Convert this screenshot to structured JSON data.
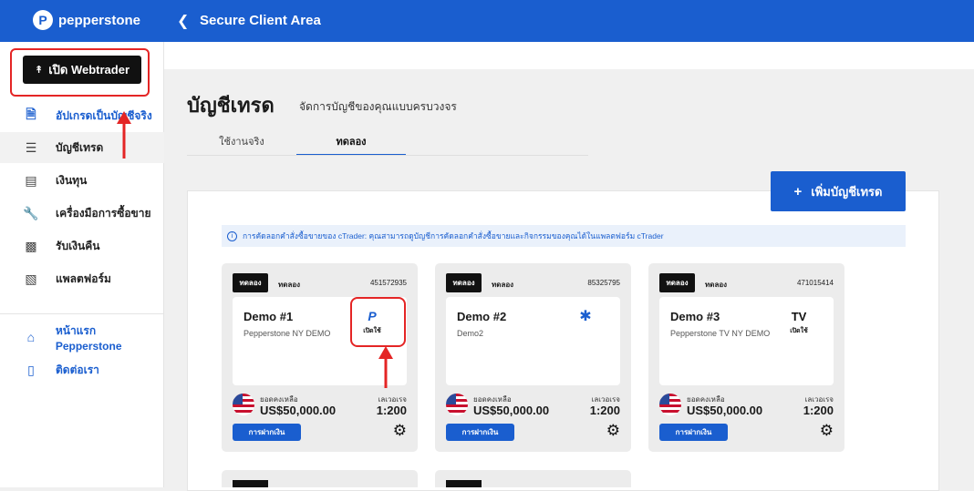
{
  "header": {
    "brand": "pepperstone",
    "back_icon": "chevron-left-icon",
    "title": "Secure Client Area"
  },
  "sidebar": {
    "webtrader_label": "เปิด Webtrader",
    "items": [
      {
        "label": "อัปเกรดเป็นบัญชีจริง",
        "icon": "document-icon"
      },
      {
        "label": "บัญชีเทรด",
        "icon": "layers-icon"
      },
      {
        "label": "เงินทุน",
        "icon": "wallet-icon"
      },
      {
        "label": "เครื่องมือการซื้อขาย",
        "icon": "wrench-icon"
      },
      {
        "label": "รับเงินคืน",
        "icon": "user-card-icon"
      },
      {
        "label": "แพลตฟอร์ม",
        "icon": "bar-chart-icon"
      },
      {
        "label": "หน้าแรก Pepperstone",
        "icon": "home-icon"
      },
      {
        "label": "ติดต่อเรา",
        "icon": "phone-icon"
      }
    ]
  },
  "main": {
    "title": "บัญชีเทรด",
    "subtitle": "จัดการบัญชีของคุณแบบครบวงจร",
    "tabs": [
      {
        "label": "ใช้งานจริง",
        "active": false
      },
      {
        "label": "ทดลอง",
        "active": true
      }
    ],
    "add_account_label": "เพิ่มบัญชีเทรด",
    "info_text": "การคัดลอกคำสั่งซื้อขายของ cTrader: คุณสามารถดูบัญชีการคัดลอกคำสั่งซื้อขายและกิจกรรมของคุณได้ในแพลตฟอร์ม cTrader"
  },
  "cards": [
    {
      "badge": "ทดลอง",
      "type": "ทดลอง",
      "account_no": "451572935",
      "name": "Demo #1",
      "server": "Pepperstone NY DEMO",
      "platform": "pepperstone-icon",
      "platform_label": "เปิดใช้",
      "balance_label": "ยอดคงเหลือ",
      "balance": "US$50,000.00",
      "leverage_label": "เลเวอเรจ",
      "leverage": "1:200",
      "deposit_label": "การฝากเงิน"
    },
    {
      "badge": "ทดลอง",
      "type": "ทดลอง",
      "account_no": "85325795",
      "name": "Demo #2",
      "server": "Demo2",
      "platform": "metatrader-icon",
      "platform_label": "",
      "balance_label": "ยอดคงเหลือ",
      "balance": "US$50,000.00",
      "leverage_label": "เลเวอเรจ",
      "leverage": "1:200",
      "deposit_label": "การฝากเงิน"
    },
    {
      "badge": "ทดลอง",
      "type": "ทดลอง",
      "account_no": "471015414",
      "name": "Demo #3",
      "server": "Pepperstone TV NY DEMO",
      "platform": "tradingview-icon",
      "platform_label": "เปิดใช้",
      "balance_label": "ยอดคงเหลือ",
      "balance": "US$50,000.00",
      "leverage_label": "เลเวอเรจ",
      "leverage": "1:200",
      "deposit_label": "การฝากเงิน"
    }
  ],
  "colors": {
    "brand_blue": "#1a5ecf",
    "highlight_red": "#e42525"
  }
}
